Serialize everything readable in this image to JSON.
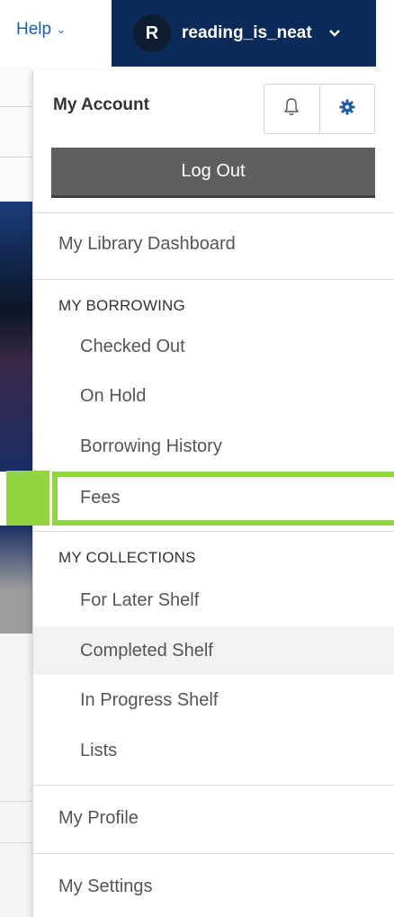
{
  "header": {
    "help_label": "Help",
    "account": {
      "avatar_initial": "R",
      "username": "reading_is_neat"
    }
  },
  "dropdown": {
    "title": "My Account",
    "notifications_icon": "bell-icon",
    "settings_icon": "gear-icon",
    "logout_label": "Log Out",
    "dashboard_label": "My Library Dashboard",
    "borrowing": {
      "heading": "MY BORROWING",
      "items": [
        "Checked Out",
        "On Hold",
        "Borrowing History",
        "Fees"
      ]
    },
    "collections": {
      "heading": "MY COLLECTIONS",
      "items": [
        "For Later Shelf",
        "Completed Shelf",
        "In Progress Shelf",
        "Lists"
      ]
    },
    "profile_label": "My Profile",
    "settings_label": "My Settings"
  },
  "colors": {
    "account_bar": "#0a2b57",
    "logout_button": "#5f5f5f",
    "highlight": "#92d63f",
    "link": "#1f5fa5"
  }
}
